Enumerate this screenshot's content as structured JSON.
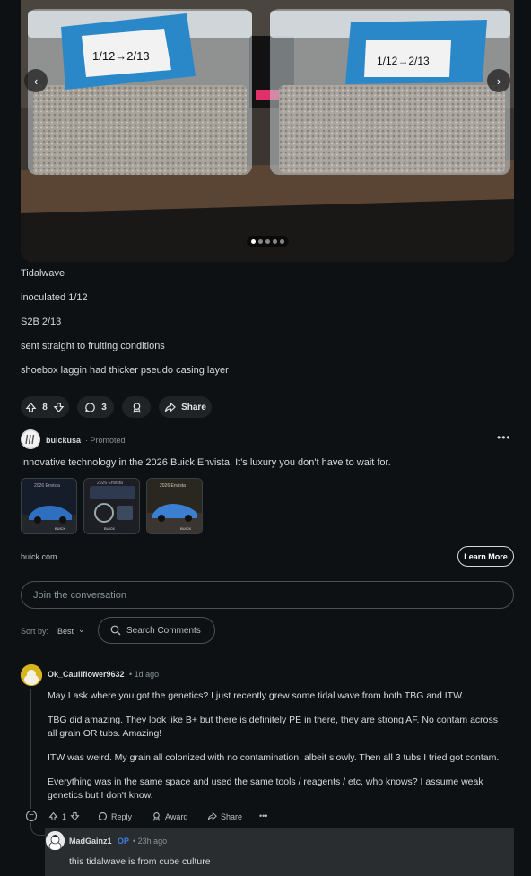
{
  "post": {
    "lines": [
      "Tidalwave",
      "inoculated 1/12",
      "S2B 2/13",
      "sent straight to fruiting conditions",
      "shoebox laggin had thicker pseudo casing layer"
    ],
    "image": {
      "left_label": "1/12→2/13",
      "right_label": "1/12→2/13",
      "active_slide": 1,
      "slide_count": 5
    },
    "actions": {
      "vote_count": "8",
      "comment_count": "3",
      "share_label": "Share"
    }
  },
  "ad": {
    "username": "buickusa",
    "promoted_label": "Promoted",
    "more_label": "•••",
    "headline": "Innovative technology in the 2026 Buick Envista. It's luxury you don't have to wait for.",
    "thumb_label": "2026 Envista",
    "thumb_brand": "BUICK",
    "domain": "buick.com",
    "cta": "Learn More"
  },
  "comments_section": {
    "join_placeholder": "Join the conversation",
    "sort_label": "Sort by:",
    "sort_value": "Best",
    "search_label": "Search Comments"
  },
  "comment": {
    "username": "Ok_Cauliflower9632",
    "time": "• 1d ago",
    "paragraphs": [
      "May I ask where you got the genetics? I just recently grew some tidal wave from both TBG and ITW.",
      "TBG did amazing. They look like B+ but there is definitely PE in there, they are strong AF. No contam across all grain OR tubs. Amazing!",
      "ITW was weird. My grain all colonized with no contamination, albeit slowly. Then all 3 tubs I tried got contam.",
      "Everything was in the same space and used the same tools / reagents / etc, who knows? I assume weak genetics but I don't know."
    ],
    "vote_count": "1",
    "reply_label": "Reply",
    "award_label": "Award",
    "share_label": "Share",
    "more_label": "•••",
    "collapse_label": "−"
  },
  "reply": {
    "username": "MadGainz1",
    "op_badge": "OP",
    "time": "• 23h ago",
    "text": "this tidalwave is from cube culture"
  },
  "colors": {
    "background": "#0e1113",
    "pill": "#1f2326",
    "op_blue": "#3d7ee0",
    "avatar_yellow": "#d7b51f",
    "reply_highlight": "#2a2d30"
  }
}
